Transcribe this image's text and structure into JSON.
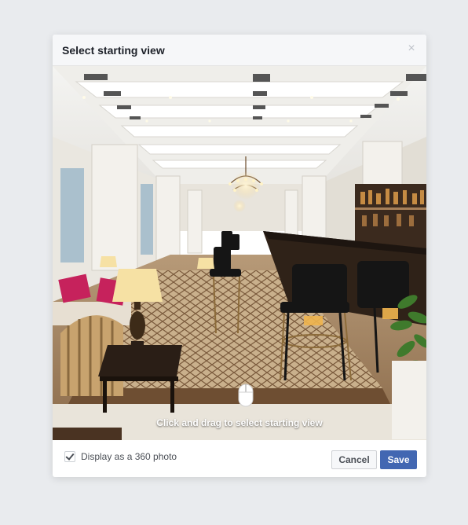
{
  "dialog": {
    "title": "Select starting view",
    "close_symbol": "×"
  },
  "viewer": {
    "hint": "Click and drag to select starting view",
    "cursor_icon": "mouse-icon"
  },
  "footer": {
    "checkbox_label": "Display as a 360 photo",
    "checkbox_checked": true,
    "cancel_label": "Cancel",
    "save_label": "Save"
  },
  "colors": {
    "accent": "#4267b2",
    "background": "#e9ebee"
  }
}
